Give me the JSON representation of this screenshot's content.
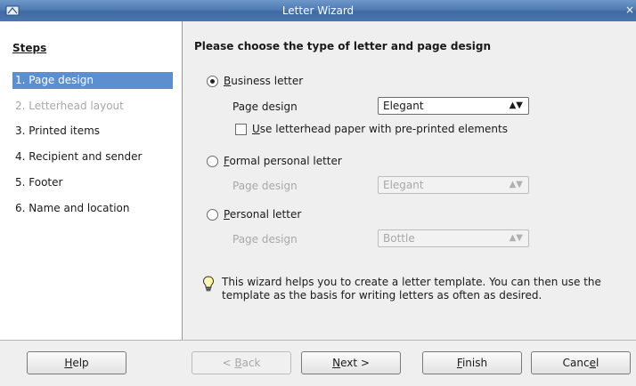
{
  "window": {
    "title": "Letter Wizard",
    "close_glyph": "×"
  },
  "sidebar": {
    "title": "Steps",
    "items": [
      {
        "label": "1. Page design",
        "state": "selected"
      },
      {
        "label": "2. Letterhead layout",
        "state": "disabled"
      },
      {
        "label": "3. Printed items",
        "state": "normal"
      },
      {
        "label": "4. Recipient and sender",
        "state": "normal"
      },
      {
        "label": "5. Footer",
        "state": "normal"
      },
      {
        "label": "6. Name and location",
        "state": "normal"
      }
    ]
  },
  "main": {
    "heading": "Please choose the type of letter and page design",
    "options": [
      {
        "mnemonic": "B",
        "rest": "usiness letter",
        "checked": true,
        "page_design_label": "Page design",
        "page_design_value": "Elegant",
        "enabled": true
      },
      {
        "mnemonic": "F",
        "rest": "ormal personal letter",
        "checked": false,
        "page_design_label": "Page design",
        "page_design_value": "Elegant",
        "enabled": false
      },
      {
        "mnemonic": "P",
        "rest": "ersonal letter",
        "checked": false,
        "page_design_label": "Page design",
        "page_design_value": "Bottle",
        "enabled": false
      }
    ],
    "letterhead_checkbox": {
      "mnemonic": "U",
      "rest": "se letterhead paper with pre-printed elements",
      "checked": false
    },
    "info_line1": "This wizard helps you to create a letter template. You can then use the",
    "info_line2": "template as the basis for writing letters as often as desired."
  },
  "buttons": {
    "help": {
      "mnemonic": "H",
      "rest": "elp"
    },
    "back": {
      "prefix": "< ",
      "mnemonic": "B",
      "rest": "ack"
    },
    "next": {
      "mnemonic": "N",
      "rest": "ext >"
    },
    "finish": {
      "mnemonic": "F",
      "rest": "inish"
    },
    "cancel": {
      "prefix": "Canc",
      "mnemonic": "e",
      "rest": "l"
    }
  },
  "colors": {
    "selection": "#5c8fcf",
    "titlebar": "#4e7bb3"
  }
}
